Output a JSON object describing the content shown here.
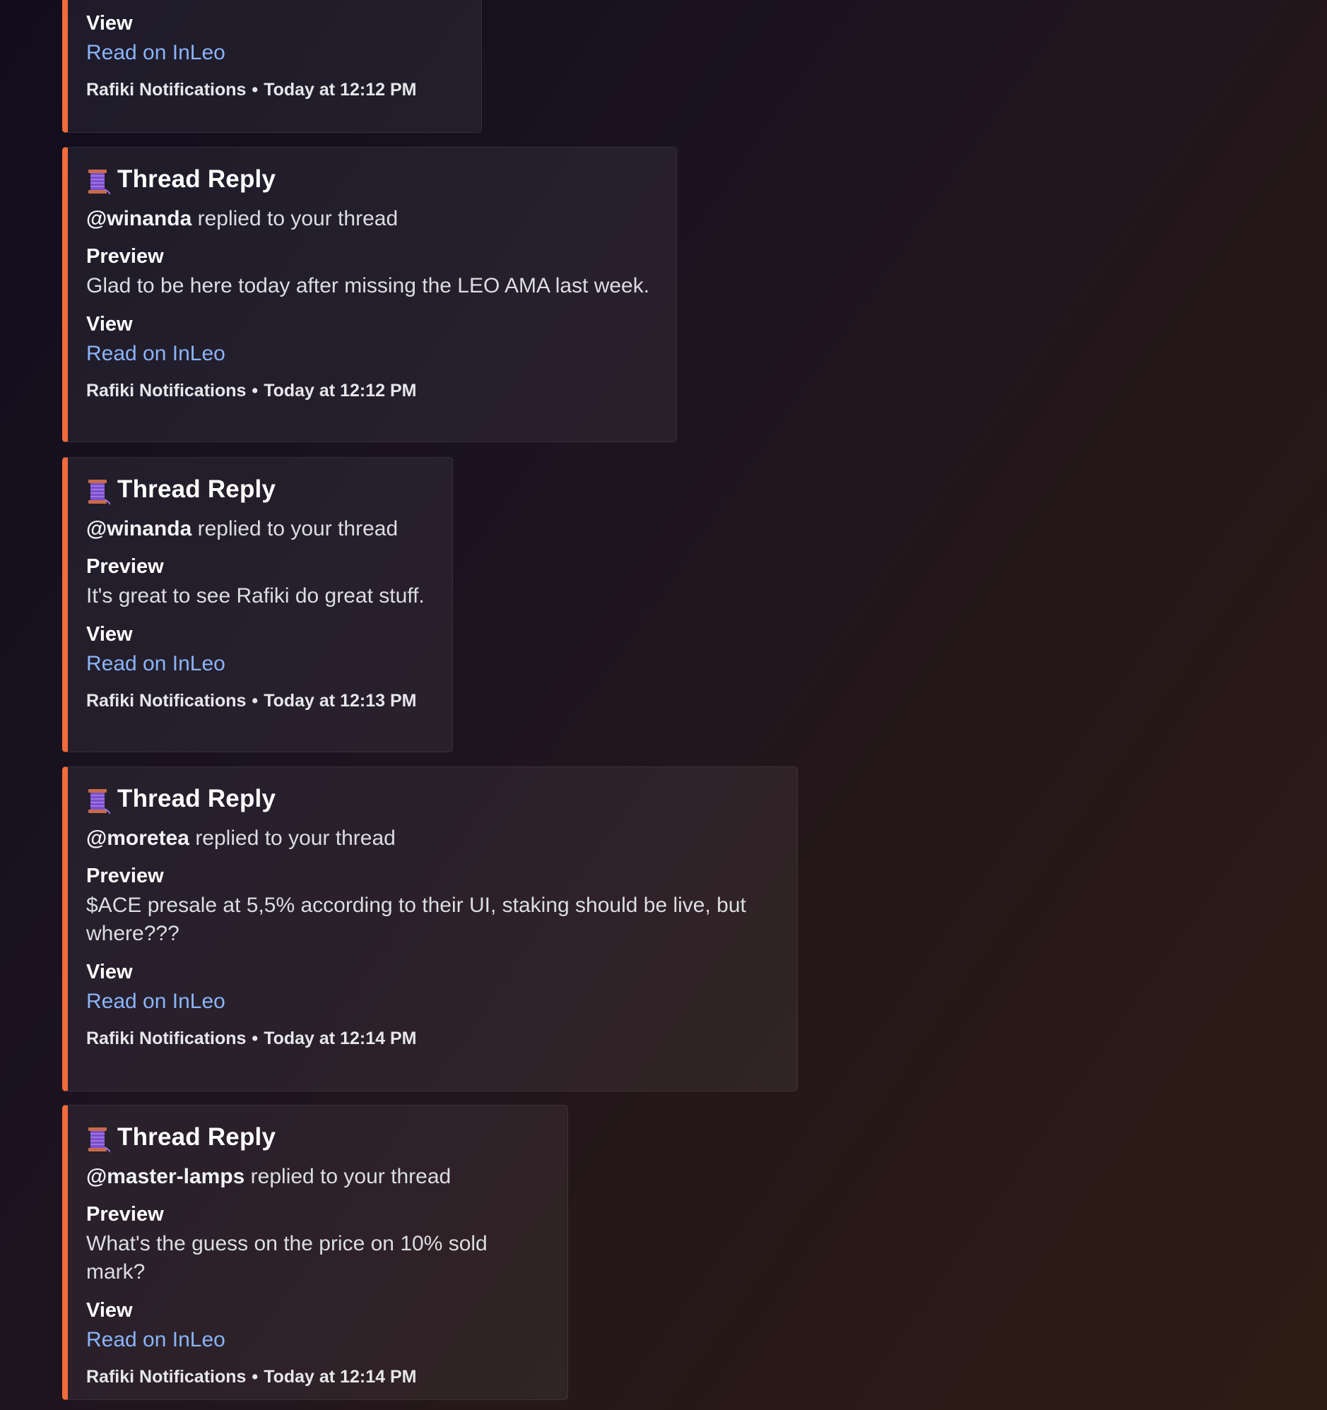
{
  "partial_embed": {
    "view_label": "View",
    "link_text": "Read on InLeo",
    "footer_source": "Rafiki Notifications",
    "footer_separator": "•",
    "footer_time": "Today at 12:12 PM"
  },
  "notifications": [
    {
      "icon": "thread-spool-icon",
      "title": "Thread Reply",
      "user": "@winanda",
      "action": " replied to your thread",
      "preview_label": "Preview",
      "preview": "Glad to be here today after missing the LEO AMA last week.",
      "view_label": "View",
      "link_text": "Read on InLeo",
      "footer_source": "Rafiki Notifications",
      "footer_separator": "•",
      "footer_time": "Today at 12:12 PM"
    },
    {
      "icon": "thread-spool-icon",
      "title": "Thread Reply",
      "user": "@winanda",
      "action": " replied to your thread",
      "preview_label": "Preview",
      "preview": "It's great to see Rafiki do great stuff.",
      "view_label": "View",
      "link_text": "Read on InLeo",
      "footer_source": "Rafiki Notifications",
      "footer_separator": "•",
      "footer_time": "Today at 12:13 PM"
    },
    {
      "icon": "thread-spool-icon",
      "title": "Thread Reply",
      "user": "@moretea",
      "action": " replied to your thread",
      "preview_label": "Preview",
      "preview": "$ACE presale at 5,5% according to their UI, staking should be live, but where???",
      "view_label": "View",
      "link_text": "Read on InLeo",
      "footer_source": "Rafiki Notifications",
      "footer_separator": "•",
      "footer_time": "Today at 12:14 PM"
    },
    {
      "icon": "thread-spool-icon",
      "title": "Thread Reply",
      "user": "@master-lamps",
      "action": " replied to your thread",
      "preview_label": "Preview",
      "preview": "What's the guess on the price on 10% sold mark?",
      "view_label": "View",
      "link_text": "Read on InLeo",
      "footer_source": "Rafiki Notifications",
      "footer_separator": "•",
      "footer_time": "Today at 12:14 PM"
    }
  ],
  "colors": {
    "accent_bar": "#f26b3a",
    "link": "#8ab4f8",
    "spool_thread": "#7b4fc9",
    "spool_wood": "#c76b4a"
  }
}
